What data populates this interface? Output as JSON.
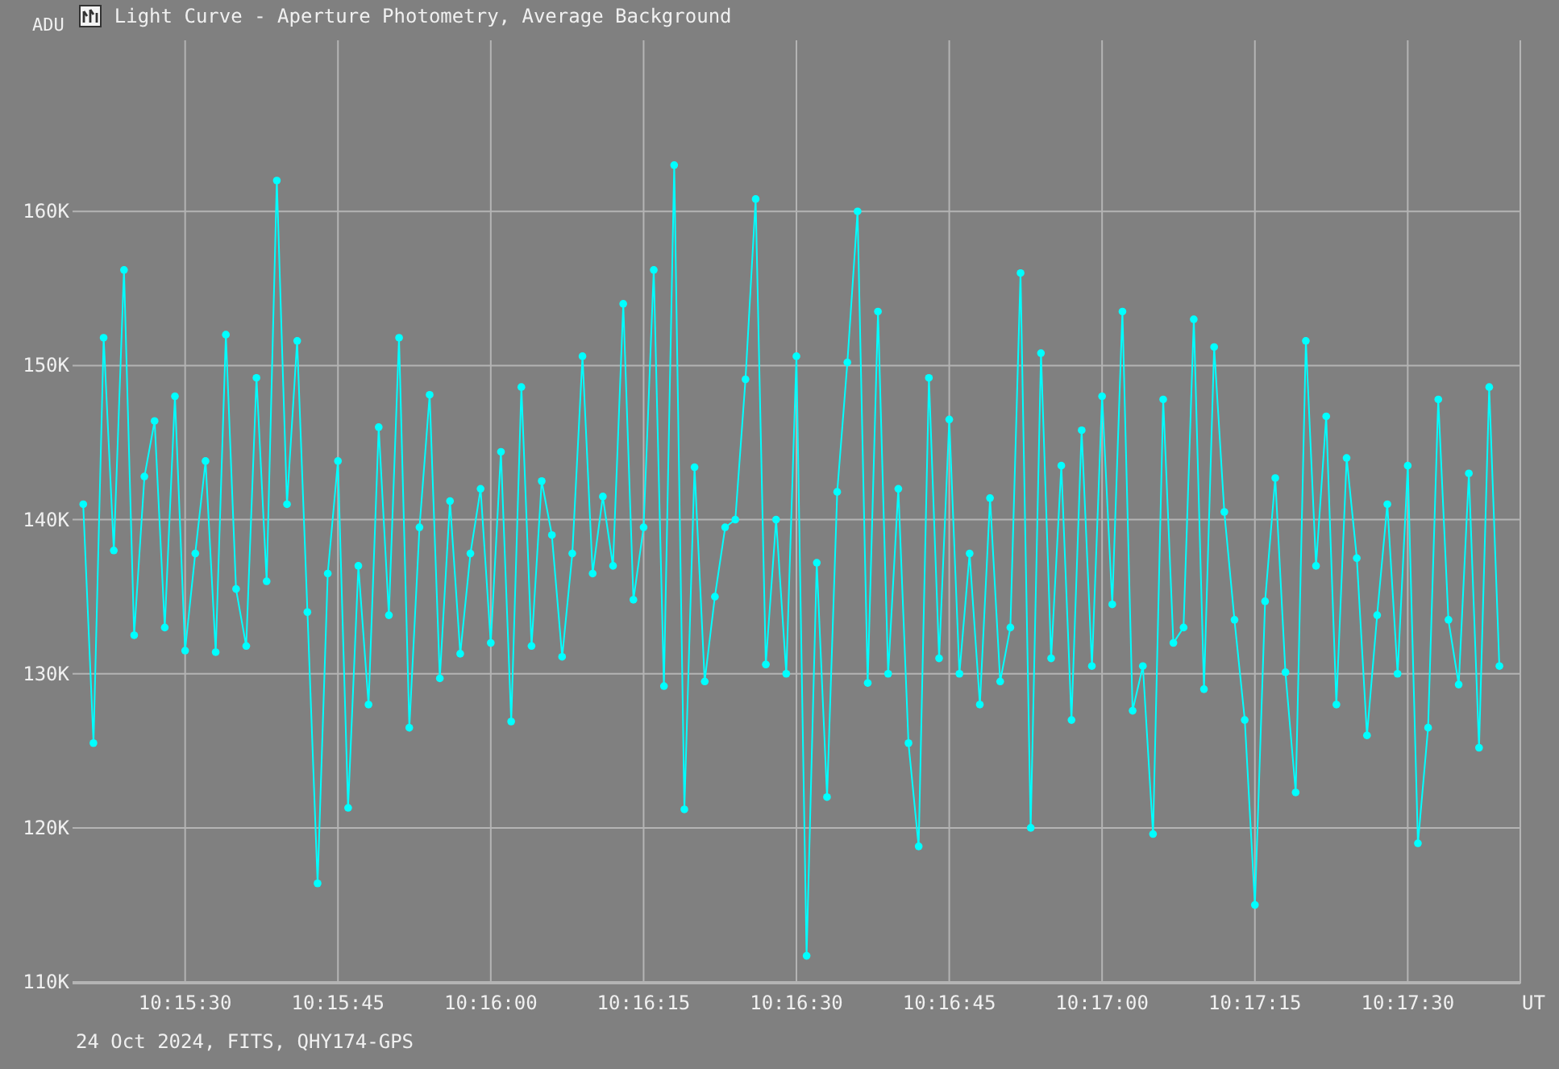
{
  "window": {
    "title": "Light Curve - Aperture Photometry, Average Background"
  },
  "chart": {
    "chart_data": {
      "type": "line",
      "ylabel": "ADU",
      "xlabel": "UT",
      "grid": true,
      "categories": [
        null,
        null,
        null,
        null,
        null,
        null,
        null,
        null,
        null,
        null,
        "10:15:30",
        null,
        null,
        null,
        null,
        null,
        null,
        null,
        null,
        null,
        null,
        null,
        null,
        null,
        null,
        "10:15:45",
        null,
        null,
        null,
        null,
        null,
        null,
        null,
        null,
        null,
        null,
        null,
        null,
        null,
        null,
        "10:16:00",
        null,
        null,
        null,
        null,
        null,
        null,
        null,
        null,
        null,
        null,
        null,
        null,
        null,
        null,
        "10:16:15",
        null,
        null,
        null,
        null,
        null,
        null,
        null,
        null,
        null,
        null,
        null,
        null,
        null,
        null,
        "10:16:30",
        null,
        null,
        null,
        null,
        null,
        null,
        null,
        null,
        null,
        null,
        null,
        null,
        null,
        null,
        "10:16:45",
        null,
        null,
        null,
        null,
        null,
        null,
        null,
        null,
        null,
        null,
        null,
        null,
        null,
        null,
        "10:17:00",
        null,
        null,
        null,
        null,
        null,
        null,
        null,
        null,
        null,
        null,
        null,
        null,
        null,
        null,
        "10:17:15",
        null,
        null,
        null,
        null,
        null,
        null,
        null,
        null,
        null,
        null,
        null,
        null,
        null,
        null,
        "10:17:30",
        null,
        null,
        null,
        null,
        null,
        null,
        null,
        null,
        null
      ],
      "series": [
        {
          "color": "#00ffff",
          "marker": "circle",
          "values": [
            141000,
            125500,
            151800,
            138000,
            156200,
            132500,
            142800,
            146400,
            133000,
            148000,
            131500,
            137800,
            143800,
            131400,
            152000,
            135500,
            131800,
            149200,
            136000,
            162000,
            141000,
            151600,
            134000,
            116400,
            136500,
            143800,
            121300,
            137000,
            128000,
            146000,
            133800,
            151800,
            126500,
            139500,
            148100,
            129700,
            141200,
            131300,
            137800,
            142000,
            132000,
            144400,
            126900,
            148600,
            131800,
            142500,
            139000,
            131100,
            137800,
            150600,
            136500,
            141500,
            137000,
            154000,
            134800,
            139500,
            156200,
            129200,
            163000,
            121200,
            143400,
            129500,
            135000,
            139500,
            140000,
            149100,
            160800,
            130600,
            140000,
            130000,
            150600,
            111700,
            137200,
            122000,
            141800,
            150200,
            160000,
            129400,
            153500,
            130000,
            142000,
            125500,
            118800,
            149200,
            131000,
            146500,
            130000,
            137800,
            128000,
            141400,
            129500,
            133000,
            156000,
            120000,
            150800,
            131000,
            143500,
            127000,
            145800,
            130500,
            148000,
            134500,
            153500,
            127600,
            130500,
            119600,
            147800,
            132000,
            133000,
            153000,
            129000,
            151200,
            140500,
            133500,
            127000,
            115000,
            134700,
            142700,
            130100,
            122300,
            151600,
            137000,
            146700,
            128000,
            144000,
            137500,
            126000,
            133800,
            141000,
            130000,
            143500,
            119000,
            126500,
            147800,
            133500,
            129300,
            143000,
            125200,
            148600,
            130500
          ]
        }
      ],
      "ylim": [
        109900,
        171100
      ],
      "yticks": [
        {
          "value": 110000,
          "label": "110K"
        },
        {
          "value": 120000,
          "label": "120K"
        },
        {
          "value": 130000,
          "label": "130K"
        },
        {
          "value": 140000,
          "label": "140K"
        },
        {
          "value": 150000,
          "label": "150K"
        },
        {
          "value": 160000,
          "label": "160K"
        }
      ]
    }
  },
  "status_bar": {
    "text": "24 Oct 2024, FITS, QHY174-GPS"
  }
}
